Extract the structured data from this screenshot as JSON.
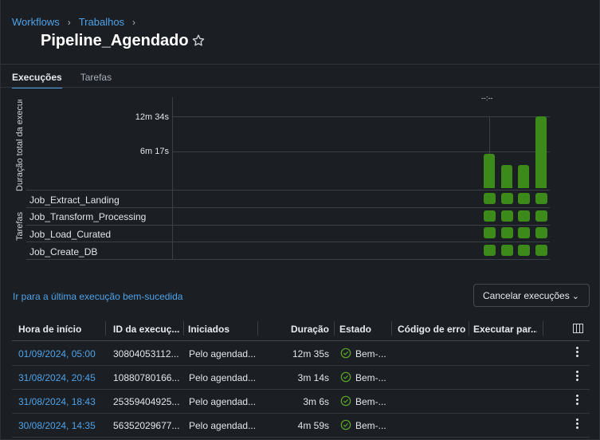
{
  "breadcrumb": {
    "items": [
      "Workflows",
      "Trabalhos"
    ]
  },
  "title": "Pipeline_Agendado",
  "tabs": [
    {
      "label": "Execuções",
      "active": true
    },
    {
      "label": "Tarefas",
      "active": false
    }
  ],
  "chart": {
    "y_title": "Duração total da execução",
    "tasks_title": "Tarefas",
    "top_marker": "--:--",
    "ticks": [
      "12m 34s",
      "6m 17s"
    ],
    "tasks": [
      "Job_Extract_Landing",
      "Job_Transform_Processing",
      "Job_Load_Curated",
      "Job_Create_DB"
    ]
  },
  "chart_data": {
    "type": "bar",
    "ylabel": "Duração total da execução",
    "y_ticks_seconds": [
      377,
      754
    ],
    "values_seconds": [
      359,
      247,
      246,
      755
    ],
    "task_status": "success",
    "colors": {
      "bar": "#3c8a1a"
    }
  },
  "link_last_success": "Ir para a última execução bem-sucedida",
  "cancel_button": {
    "label": "Cancelar execuções"
  },
  "table": {
    "headers": [
      "Hora de início",
      "ID da execução",
      "Iniciados",
      "Duração",
      "Estado",
      "Código de erro",
      "Executar par..."
    ],
    "headers_display": [
      "Hora de início",
      "ID da execuç...",
      "Iniciados",
      "Duração",
      "Estado",
      "Código de erro",
      "Executar par..."
    ],
    "rows": [
      {
        "start": "01/09/2024, 05:00",
        "id": "30804053112...",
        "by": "Pelo agendad...",
        "duration": "12m 35s",
        "state": "Bem-..."
      },
      {
        "start": "31/08/2024, 20:45",
        "id": "10880780166...",
        "by": "Pelo agendad...",
        "duration": "3m 14s",
        "state": "Bem-..."
      },
      {
        "start": "31/08/2024, 18:43",
        "id": "25359404925...",
        "by": "Pelo agendad...",
        "duration": "3m 6s",
        "state": "Bem-..."
      },
      {
        "start": "30/08/2024, 14:35",
        "id": "56352029677...",
        "by": "Pelo agendad...",
        "duration": "4m 59s",
        "state": "Bem-..."
      }
    ]
  },
  "icons": {
    "star": "star-outline-icon",
    "columns": "columns-icon",
    "kebab": "kebab-menu-icon",
    "success": "check-circle-icon"
  },
  "colors": {
    "accent": "#4ea3ea",
    "success": "#3c8a1a",
    "background": "#1b1e22"
  }
}
